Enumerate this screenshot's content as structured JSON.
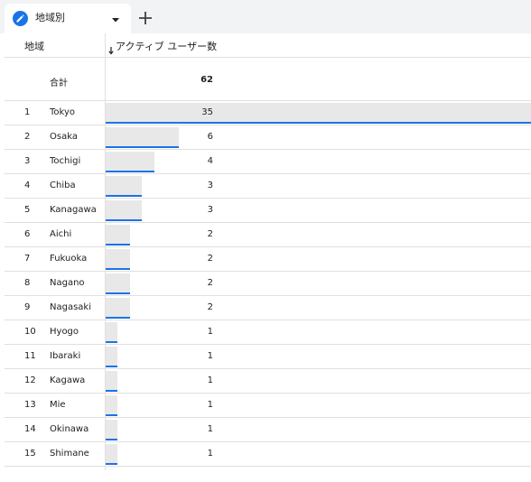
{
  "tab": {
    "label": "地域別",
    "accent": "#1a73e8"
  },
  "table": {
    "dimension_header": "地域",
    "metric_header": "アクティブ ユーザー数",
    "sort": "descending",
    "total_label": "合計",
    "total_value": "62",
    "bar_color": "#e8e8e8",
    "bar_line_color": "#1a73e8",
    "rows": [
      {
        "rank": "1",
        "region": "Tokyo",
        "value": "35"
      },
      {
        "rank": "2",
        "region": "Osaka",
        "value": "6"
      },
      {
        "rank": "3",
        "region": "Tochigi",
        "value": "4"
      },
      {
        "rank": "4",
        "region": "Chiba",
        "value": "3"
      },
      {
        "rank": "5",
        "region": "Kanagawa",
        "value": "3"
      },
      {
        "rank": "6",
        "region": "Aichi",
        "value": "2"
      },
      {
        "rank": "7",
        "region": "Fukuoka",
        "value": "2"
      },
      {
        "rank": "8",
        "region": "Nagano",
        "value": "2"
      },
      {
        "rank": "9",
        "region": "Nagasaki",
        "value": "2"
      },
      {
        "rank": "10",
        "region": "Hyogo",
        "value": "1"
      },
      {
        "rank": "11",
        "region": "Ibaraki",
        "value": "1"
      },
      {
        "rank": "12",
        "region": "Kagawa",
        "value": "1"
      },
      {
        "rank": "13",
        "region": "Mie",
        "value": "1"
      },
      {
        "rank": "14",
        "region": "Okinawa",
        "value": "1"
      },
      {
        "rank": "15",
        "region": "Shimane",
        "value": "1"
      }
    ]
  }
}
